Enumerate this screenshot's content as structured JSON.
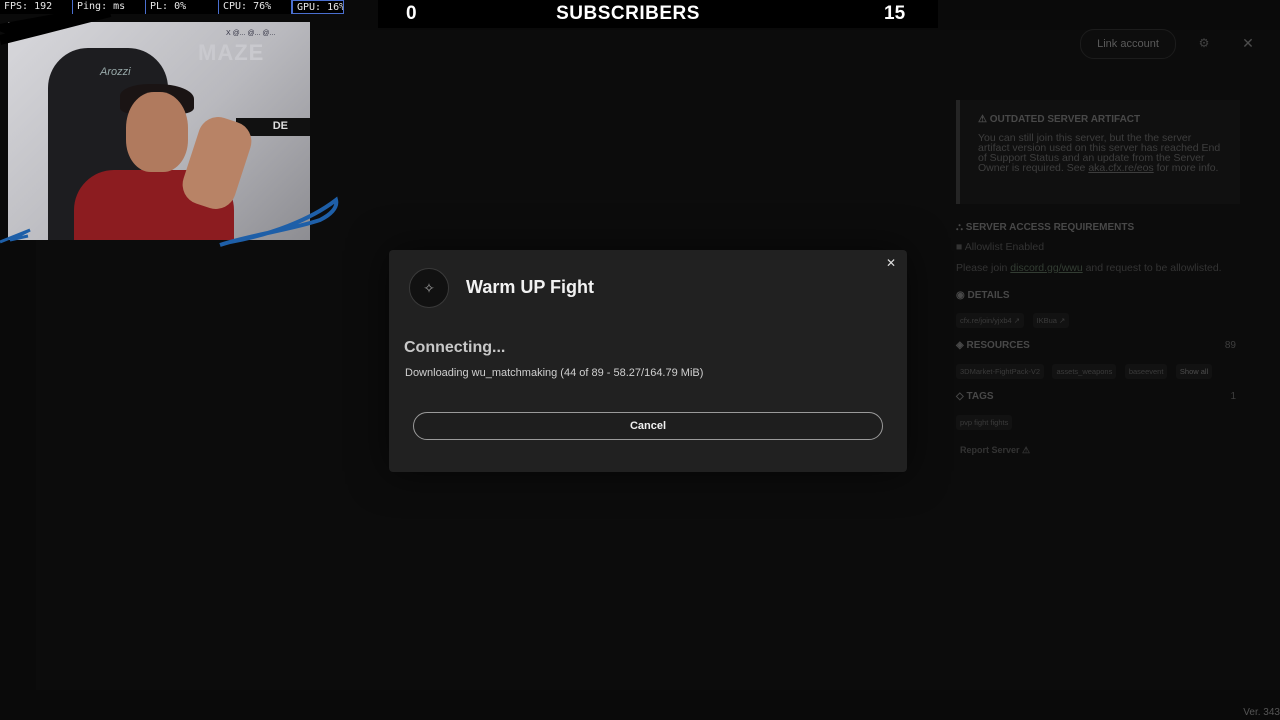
{
  "overlay_stats": [
    "FPS: 192",
    "Ping: ms",
    "PL: 0%",
    "CPU: 76%",
    "GPU: 16%"
  ],
  "subscriber_bar": {
    "left_count": "0",
    "title": "SUBSCRIBERS",
    "right_count": "15"
  },
  "webcam": {
    "logo_text": "MAZE",
    "socials_text": "X @... @... @...",
    "chair_brand": "Arozzi",
    "monitor_text": "DE"
  },
  "header": {
    "link_account": "Link account"
  },
  "server_panel": {
    "warning_title": "OUTDATED SERVER ARTIFACT",
    "warning_text_1": "You can still join this server, but the the server artifact version used on this server has reached End of Support Status and an update from the Server Owner is required. See ",
    "warning_link": "aka.cfx.re/eos",
    "warning_text_2": " for more info.",
    "access_title": "SERVER ACCESS REQUIREMENTS",
    "allowlist_label": "Allowlist Enabled",
    "access_text_1": "Please join ",
    "access_link": "discord.gg/wwu",
    "access_text_2": " and request to be allowlisted.",
    "details_title": "DETAILS",
    "details_chips": [
      "cfx.re/join/yjxb4 ↗",
      "IKBua ↗"
    ],
    "resources_title": "RESOURCES",
    "resources_count": "89",
    "resource_chips": [
      "3DMarket-FightPack-V2",
      "assets_weapons",
      "baseevent"
    ],
    "show_all": "Show all",
    "tags_title": "TAGS",
    "tags_count": "1",
    "tag_chips": [
      "pvp fight fights"
    ],
    "report_server": "Report Server"
  },
  "modal": {
    "server_name": "Warm UP Fight",
    "status": "Connecting...",
    "progress": "Downloading wu_matchmaking (44 of 89 - 58.27/164.79 MiB)",
    "cancel_label": "Cancel"
  },
  "version": "Ver. 343"
}
